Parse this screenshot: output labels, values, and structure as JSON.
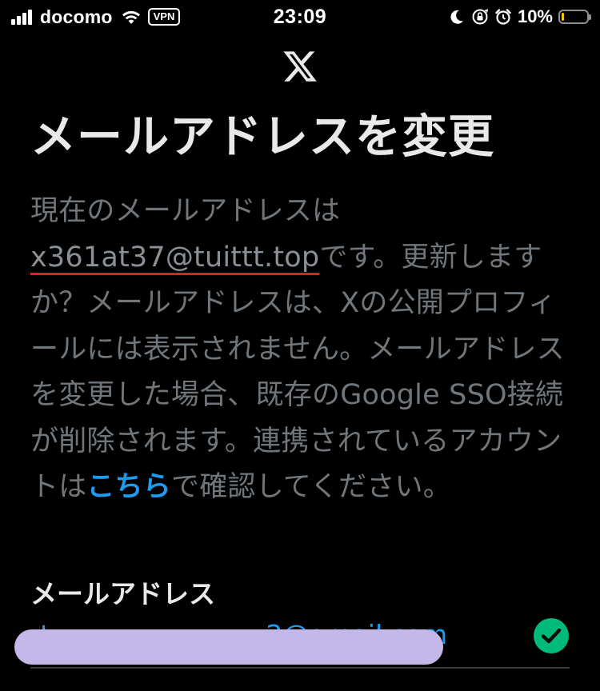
{
  "status_bar": {
    "carrier": "docomo",
    "vpn_badge": "VPN",
    "time": "23:09",
    "battery_percent": "10%",
    "battery_level": 0.1,
    "battery_color": "#f5c518",
    "icons": [
      "signal-icon",
      "wifi-icon",
      "moon-icon",
      "orientation-lock-icon",
      "alarm-icon",
      "battery-icon"
    ]
  },
  "header": {
    "logo": "x-logo-icon",
    "title": "メールアドレスを変更"
  },
  "description": {
    "prefix": "現在のメールアドレスは",
    "current_email": "x361at37@tuittt.top",
    "middle": "です。更新しますか？メールアドレスは、Xの公開プロフィールには表示されません。メールアドレスを変更した場合、既存のGoogle SSO接続が削除されます。連携されているアカウントは",
    "link_text": "こちら",
    "suffix": "で確認してください。"
  },
  "email_field": {
    "label": "メールアドレス",
    "value": "t••••••••••••• 2@gmail.com",
    "valid_icon": "check-circle-icon"
  },
  "colors": {
    "background": "#000000",
    "primary_text": "#e7e9ea",
    "secondary_text": "#71767b",
    "link": "#1d9bf0",
    "underline_annotation": "#e0201e",
    "success": "#00ba7c",
    "redaction": "#c4b8e8"
  }
}
